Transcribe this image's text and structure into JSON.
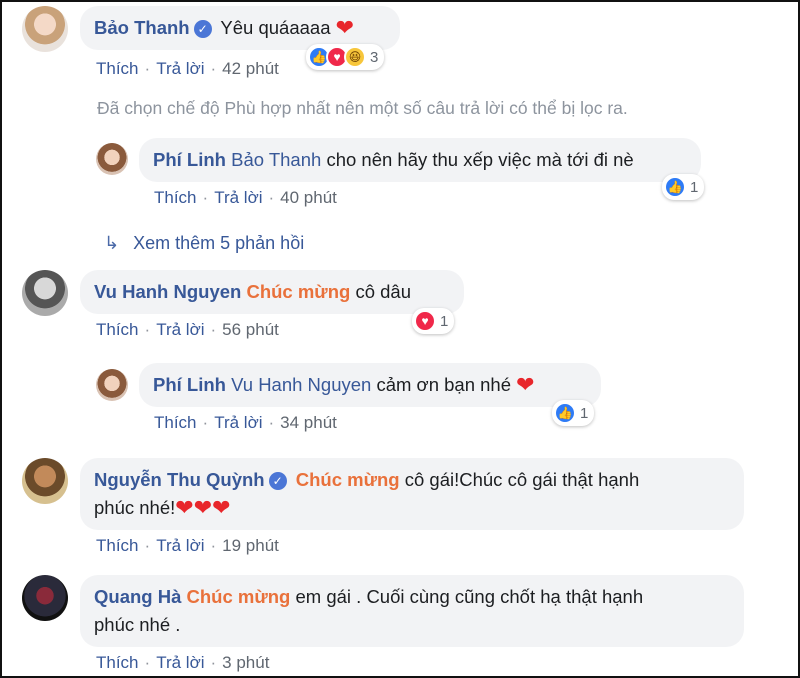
{
  "actions": {
    "like": "Thích",
    "reply": "Trả lời",
    "sep": "·"
  },
  "comments": [
    {
      "author": "Bảo Thanh",
      "text": "Yêu quáaaaa",
      "time": "42 phút",
      "reaction_count": "3"
    },
    {
      "author": "Phí Linh",
      "mention": "Bảo Thanh",
      "text": "cho nên hãy thu xếp việc mà tới đi nè",
      "time": "40 phút",
      "reaction_count": "1"
    },
    {
      "author": "Vu Hanh Nguyen",
      "tag": "Chúc mừng",
      "text": "cô dâu",
      "time": "56 phút",
      "reaction_count": "1"
    },
    {
      "author": "Phí Linh",
      "mention": "Vu Hanh Nguyen",
      "text": "cảm ơn bạn nhé",
      "time": "34 phút",
      "reaction_count": "1"
    },
    {
      "author": "Nguyễn Thu Quỳnh",
      "tag": "Chúc mừng",
      "text": "cô gái!Chúc cô gái thật hạnh",
      "text2": "phúc nhé!",
      "time": "19 phút"
    },
    {
      "author": "Quang Hà",
      "tag": "Chúc mừng",
      "text": "em gái . Cuối cùng cũng chốt hạ thật hạnh",
      "text2": "phúc nhé .",
      "time": "3 phút"
    }
  ],
  "filter_notice": "Đã chọn chế độ Phù hợp nhất nên một số câu trả lời có thể bị lọc ra.",
  "view_more": "Xem thêm 5 phản hồi",
  "colors": {
    "author": "#385898",
    "tag": "#e9713b",
    "bubble": "#f2f3f5",
    "heart": "#e8262b"
  }
}
